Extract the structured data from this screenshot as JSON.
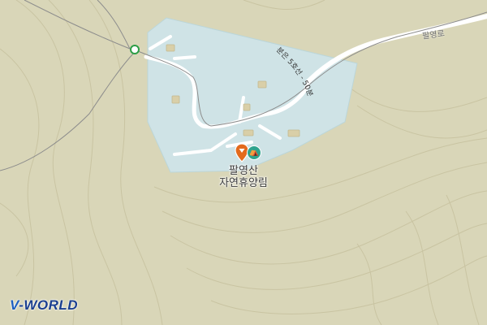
{
  "map": {
    "poi": {
      "name_line1": "팔영산",
      "name_line2": "자연휴양림",
      "pin_icon": "location-pin-icon",
      "facility_icon": "tent-icon"
    },
    "road_label": "팔영로",
    "route_label": "분은 5호선 - 50분 1 2",
    "logo": {
      "prefix": "V",
      "rest": "-WORLD"
    },
    "colors": {
      "terrain": "#d9d6b8",
      "park": "#cfe3e6",
      "road": "#ffffff",
      "contour": "#c6c19c",
      "pin": "#e36a1c",
      "marker_green": "#2e9e46"
    }
  }
}
